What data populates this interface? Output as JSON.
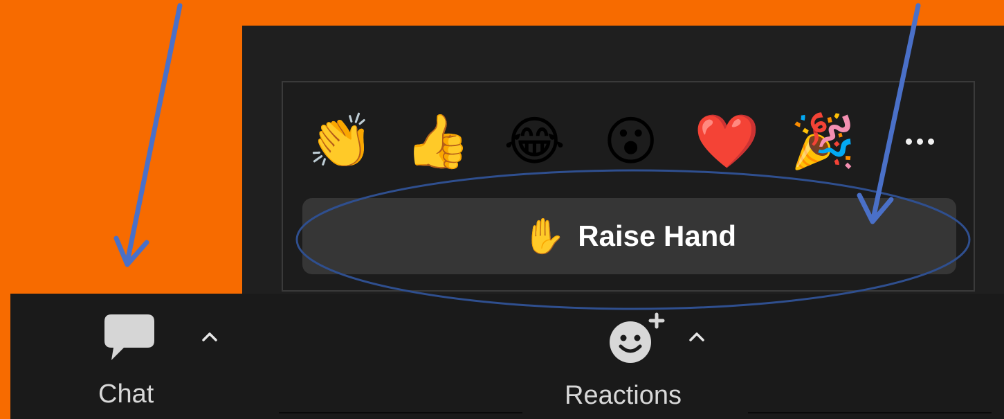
{
  "reactions": {
    "emojis": [
      {
        "name": "clapping-hands",
        "glyph": "👏"
      },
      {
        "name": "thumbs-up",
        "glyph": "👍"
      },
      {
        "name": "tears-of-joy",
        "glyph": "😂"
      },
      {
        "name": "surprised-face",
        "glyph": "😮"
      },
      {
        "name": "red-heart",
        "glyph": "❤️"
      },
      {
        "name": "party-popper",
        "glyph": "🎉"
      }
    ],
    "more_icon": "ellipsis-icon",
    "raise_hand": {
      "icon": "✋",
      "label": "Raise Hand"
    }
  },
  "toolbar": {
    "chat": {
      "label": "Chat",
      "icon": "chat-bubble-icon"
    },
    "reactions": {
      "label": "Reactions",
      "icon": "add-reaction-icon"
    }
  },
  "colors": {
    "background": "#f76b00",
    "panel": "#1f1f1f",
    "button": "#363636",
    "toolbar": "#1a1a1a",
    "annotation": "#4a70c8",
    "ellipse": "#2f4f8f"
  }
}
